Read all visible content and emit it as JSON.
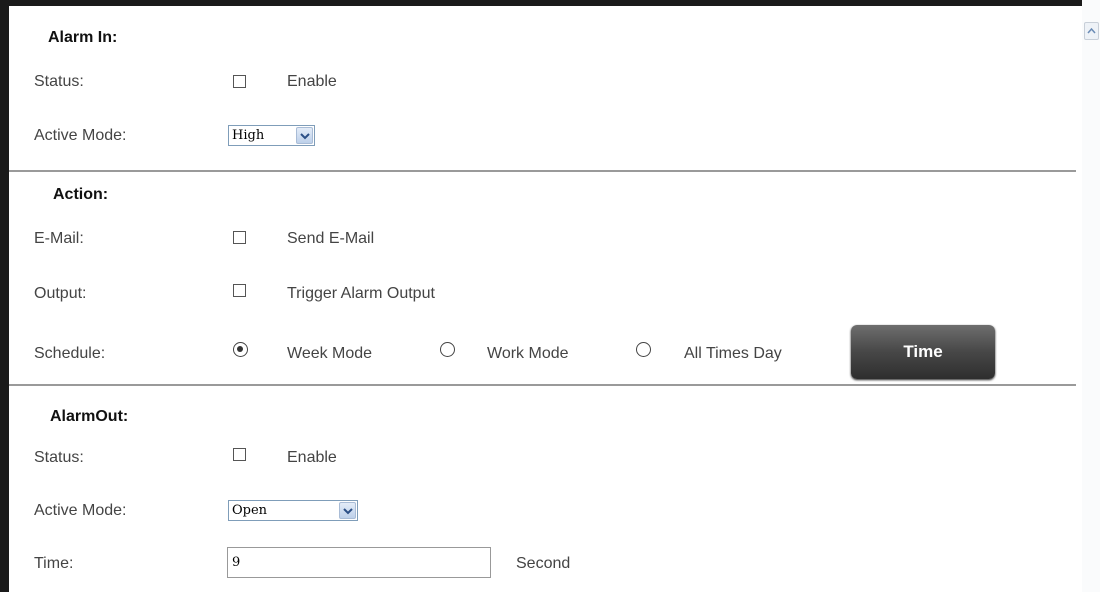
{
  "alarm_in": {
    "title": "Alarm In:",
    "status_label": "Status:",
    "status_option": "Enable",
    "active_mode_label": "Active Mode:",
    "active_mode_value": "High"
  },
  "action": {
    "title": "Action:",
    "email_label": "E-Mail:",
    "email_option": "Send E-Mail",
    "output_label": "Output:",
    "output_option": "Trigger Alarm Output",
    "schedule_label": "Schedule:",
    "schedule_options": [
      "Week Mode",
      "Work Mode",
      "All Times Day"
    ],
    "schedule_selected": "Week Mode",
    "time_button": "Time"
  },
  "alarm_out": {
    "title": "AlarmOut:",
    "status_label": "Status:",
    "status_option": "Enable",
    "active_mode_label": "Active Mode:",
    "active_mode_value": "Open",
    "time_label": "Time:",
    "time_value": "9",
    "time_unit": "Second"
  }
}
